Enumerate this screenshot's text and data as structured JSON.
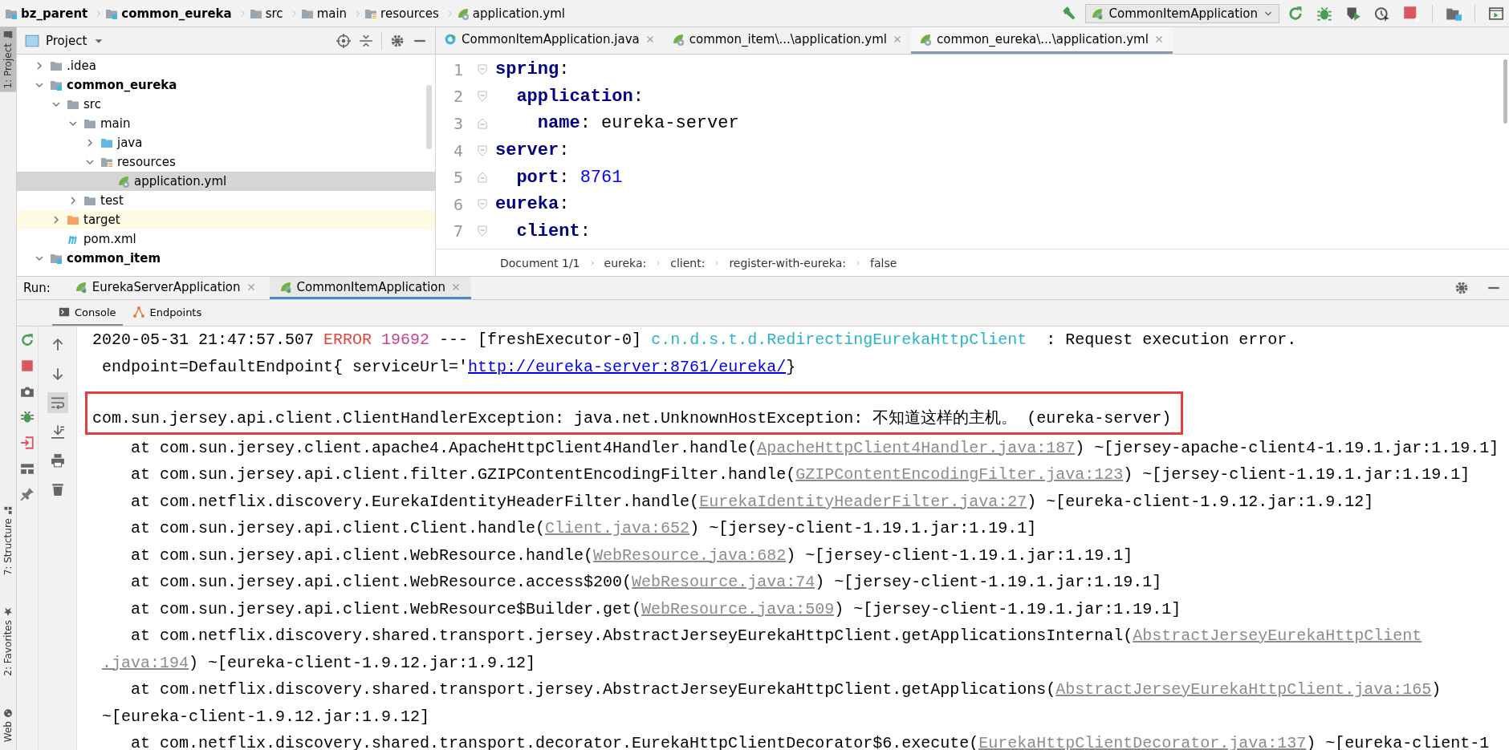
{
  "breadcrumbs": [
    {
      "label": "bz_parent",
      "kind": "module"
    },
    {
      "label": "common_eureka",
      "kind": "module"
    },
    {
      "label": "src",
      "kind": "folder"
    },
    {
      "label": "main",
      "kind": "folder"
    },
    {
      "label": "resources",
      "kind": "resources"
    },
    {
      "label": "application.yml",
      "kind": "yaml"
    }
  ],
  "run_configuration": {
    "label": "CommonItemApplication"
  },
  "project_panel": {
    "title": "Project",
    "tree": [
      {
        "label": ".idea",
        "kind": "folder",
        "expanded": false,
        "selected": false
      },
      {
        "label": "common_eureka",
        "kind": "module",
        "expanded": true,
        "selected": false,
        "children": [
          {
            "label": "src",
            "kind": "folder",
            "expanded": true,
            "selected": false,
            "children": [
              {
                "label": "main",
                "kind": "folder",
                "expanded": true,
                "selected": false,
                "children": [
                  {
                    "label": "java",
                    "kind": "source",
                    "expanded": false,
                    "selected": false
                  },
                  {
                    "label": "resources",
                    "kind": "resources",
                    "expanded": true,
                    "selected": false,
                    "children": [
                      {
                        "label": "application.yml",
                        "kind": "yaml",
                        "selected": true
                      }
                    ]
                  }
                ]
              },
              {
                "label": "test",
                "kind": "folder",
                "expanded": false,
                "selected": false
              }
            ]
          },
          {
            "label": "target",
            "kind": "excluded",
            "expanded": false,
            "selected": false
          },
          {
            "label": "pom.xml",
            "kind": "maven",
            "selected": false
          }
        ]
      },
      {
        "label": "common_item",
        "kind": "module",
        "expanded": true,
        "selected": false
      }
    ]
  },
  "editor": {
    "tabs": [
      {
        "label": "CommonItemApplication.java",
        "kind": "java",
        "selected": false
      },
      {
        "label": "common_item\\...\\application.yml",
        "kind": "yaml",
        "selected": false
      },
      {
        "label": "common_eureka\\...\\application.yml",
        "kind": "yaml",
        "selected": true
      }
    ],
    "lines": [
      {
        "number": "1",
        "fold_end": false,
        "tokens": [
          {
            "text": "spring",
            "kind": "key"
          },
          {
            "text": ":",
            "kind": "plain"
          }
        ]
      },
      {
        "number": "2",
        "fold_end": false,
        "tokens": [
          {
            "text": "  application",
            "kind": "key"
          },
          {
            "text": ":",
            "kind": "plain"
          }
        ]
      },
      {
        "number": "3",
        "fold_end": true,
        "tokens": [
          {
            "text": "    name",
            "kind": "key"
          },
          {
            "text": ": eureka-server",
            "kind": "plain"
          }
        ]
      },
      {
        "number": "4",
        "fold_end": false,
        "tokens": [
          {
            "text": "server",
            "kind": "key"
          },
          {
            "text": ":",
            "kind": "plain"
          }
        ]
      },
      {
        "number": "5",
        "fold_end": true,
        "tokens": [
          {
            "text": "  port",
            "kind": "key"
          },
          {
            "text": ": ",
            "kind": "plain"
          },
          {
            "text": "8761",
            "kind": "number"
          }
        ]
      },
      {
        "number": "6",
        "fold_end": false,
        "tokens": [
          {
            "text": "eureka",
            "kind": "key"
          },
          {
            "text": ":",
            "kind": "plain"
          }
        ]
      },
      {
        "number": "7",
        "fold_end": false,
        "tokens": [
          {
            "text": "  client",
            "kind": "key"
          },
          {
            "text": ":",
            "kind": "plain"
          }
        ]
      }
    ],
    "path": [
      "Document 1/1",
      "eureka:",
      "client:",
      "register-with-eureka:",
      "false"
    ]
  },
  "run_panel": {
    "label": "Run:",
    "tabs": [
      {
        "label": "EurekaServerApplication",
        "selected": false
      },
      {
        "label": "CommonItemApplication",
        "selected": true
      }
    ],
    "console_tabs": [
      {
        "label": "Console",
        "kind": "console",
        "selected": true
      },
      {
        "label": "Endpoints",
        "kind": "endpoints",
        "selected": false
      }
    ],
    "wrap_on": true,
    "lines": [
      {
        "kind": "plain",
        "segments": [
          {
            "text": "2020-05-31 21:47:57.507 ",
            "kind": "plain"
          },
          {
            "text": "ERROR",
            "kind": "error"
          },
          {
            "text": " 19692",
            "kind": "pid"
          },
          {
            "text": " --- [freshExecutor-0] ",
            "kind": "plain"
          },
          {
            "text": "c.n.d.s.t.d.RedirectingEurekaHttpClient",
            "kind": "logger"
          },
          {
            "text": "  : Request execution error.",
            "kind": "plain"
          }
        ]
      },
      {
        "kind": "wrap",
        "segments": [
          {
            "text": "endpoint=DefaultEndpoint{ serviceUrl='",
            "kind": "plain"
          },
          {
            "text": "http://eureka-server:8761/eureka/",
            "kind": "url"
          },
          {
            "text": "}",
            "kind": "plain"
          }
        ]
      },
      {
        "kind": "highlighted",
        "segments": [
          {
            "text": "com.sun.jersey.api.client.ClientHandlerException: java.net.UnknownHostException: 不知道这样的主机。 (eureka-server)",
            "kind": "plain"
          }
        ]
      },
      {
        "kind": "frame",
        "segments": [
          {
            "text": "at com.sun.jersey.client.apache4.ApacheHttpClient4Handler.handle(",
            "kind": "plain"
          },
          {
            "text": "ApacheHttpClient4Handler.java:187",
            "kind": "source"
          },
          {
            "text": ") ~[jersey-apache-client4-1.19.1.jar:1.19.1]",
            "kind": "plain"
          }
        ]
      },
      {
        "kind": "frame",
        "segments": [
          {
            "text": "at com.sun.jersey.api.client.filter.GZIPContentEncodingFilter.handle(",
            "kind": "plain"
          },
          {
            "text": "GZIPContentEncodingFilter.java:123",
            "kind": "source"
          },
          {
            "text": ") ~[jersey-client-1.19.1.jar:1.19.1]",
            "kind": "plain"
          }
        ]
      },
      {
        "kind": "frame",
        "segments": [
          {
            "text": "at com.netflix.discovery.EurekaIdentityHeaderFilter.handle(",
            "kind": "plain"
          },
          {
            "text": "EurekaIdentityHeaderFilter.java:27",
            "kind": "source"
          },
          {
            "text": ") ~[eureka-client-1.9.12.jar:1.9.12]",
            "kind": "plain"
          }
        ]
      },
      {
        "kind": "frame",
        "segments": [
          {
            "text": "at com.sun.jersey.api.client.Client.handle(",
            "kind": "plain"
          },
          {
            "text": "Client.java:652",
            "kind": "source"
          },
          {
            "text": ") ~[jersey-client-1.19.1.jar:1.19.1]",
            "kind": "plain"
          }
        ]
      },
      {
        "kind": "frame",
        "segments": [
          {
            "text": "at com.sun.jersey.api.client.WebResource.handle(",
            "kind": "plain"
          },
          {
            "text": "WebResource.java:682",
            "kind": "source"
          },
          {
            "text": ") ~[jersey-client-1.19.1.jar:1.19.1]",
            "kind": "plain"
          }
        ]
      },
      {
        "kind": "frame",
        "segments": [
          {
            "text": "at com.sun.jersey.api.client.WebResource.access$200(",
            "kind": "plain"
          },
          {
            "text": "WebResource.java:74",
            "kind": "source"
          },
          {
            "text": ") ~[jersey-client-1.19.1.jar:1.19.1]",
            "kind": "plain"
          }
        ]
      },
      {
        "kind": "frame",
        "segments": [
          {
            "text": "at com.sun.jersey.api.client.WebResource$Builder.get(",
            "kind": "plain"
          },
          {
            "text": "WebResource.java:509",
            "kind": "source"
          },
          {
            "text": ") ~[jersey-client-1.19.1.jar:1.19.1]",
            "kind": "plain"
          }
        ]
      },
      {
        "kind": "frame",
        "segments": [
          {
            "text": "at com.netflix.discovery.shared.transport.jersey.AbstractJerseyEurekaHttpClient.getApplicationsInternal(",
            "kind": "plain"
          },
          {
            "text": "AbstractJerseyEurekaHttpClient",
            "kind": "source"
          }
        ]
      },
      {
        "kind": "wrap",
        "segments": [
          {
            "text": ".java:194",
            "kind": "source"
          },
          {
            "text": ") ~[eureka-client-1.9.12.jar:1.9.12]",
            "kind": "plain"
          }
        ]
      },
      {
        "kind": "frame",
        "segments": [
          {
            "text": "at com.netflix.discovery.shared.transport.jersey.AbstractJerseyEurekaHttpClient.getApplications(",
            "kind": "plain"
          },
          {
            "text": "AbstractJerseyEurekaHttpClient.java:165",
            "kind": "source"
          },
          {
            "text": ")",
            "kind": "plain"
          }
        ]
      },
      {
        "kind": "wrap",
        "segments": [
          {
            "text": "~[eureka-client-1.9.12.jar:1.9.12]",
            "kind": "plain"
          }
        ]
      },
      {
        "kind": "frame",
        "segments": [
          {
            "text": "at com.netflix.discovery.shared.transport.decorator.EurekaHttpClientDecorator$6.execute(",
            "kind": "plain"
          },
          {
            "text": "EurekaHttpClientDecorator.java:137",
            "kind": "source"
          },
          {
            "text": ") ~[eureka-client-1",
            "kind": "plain"
          }
        ]
      }
    ]
  },
  "tool_stripe": {
    "top": [
      {
        "label": "1: Project",
        "selected": true
      }
    ],
    "bottom": [
      {
        "label": "7: Structure",
        "kind": "structure",
        "selected": false
      },
      {
        "label": "2: Favorites",
        "kind": "favorites",
        "selected": false
      },
      {
        "label": "Web",
        "kind": "web",
        "selected": false
      }
    ]
  }
}
